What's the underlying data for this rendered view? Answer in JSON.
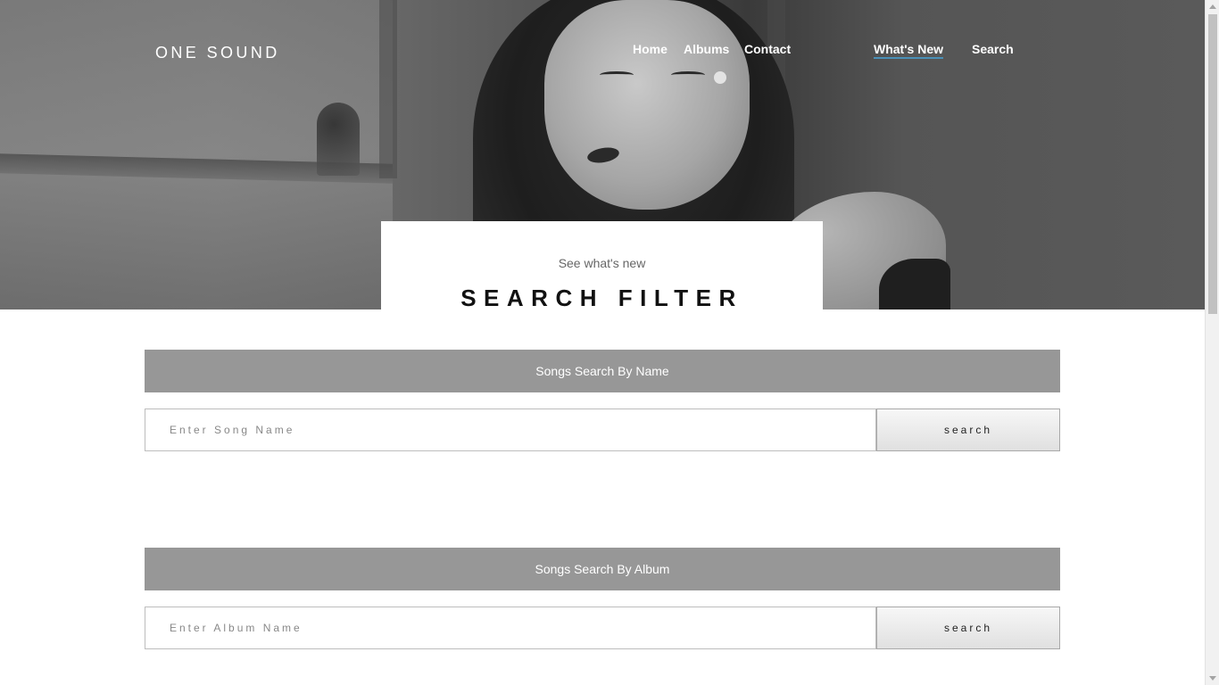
{
  "brand": "ONE SOUND",
  "nav": {
    "home": "Home",
    "albums": "Albums",
    "contact": "Contact",
    "whats_new": "What's New",
    "search": "Search"
  },
  "hero_card": {
    "kicker": "See what's new",
    "title": "SEARCH FILTER"
  },
  "song_search": {
    "heading": "Songs Search By Name",
    "placeholder": "Enter Song Name",
    "button": "search"
  },
  "album_search": {
    "heading": "Songs Search By Album",
    "placeholder": "Enter Album Name",
    "button": "search"
  },
  "colors": {
    "panel_header": "#979797",
    "active_underline": "#4a90b8"
  }
}
